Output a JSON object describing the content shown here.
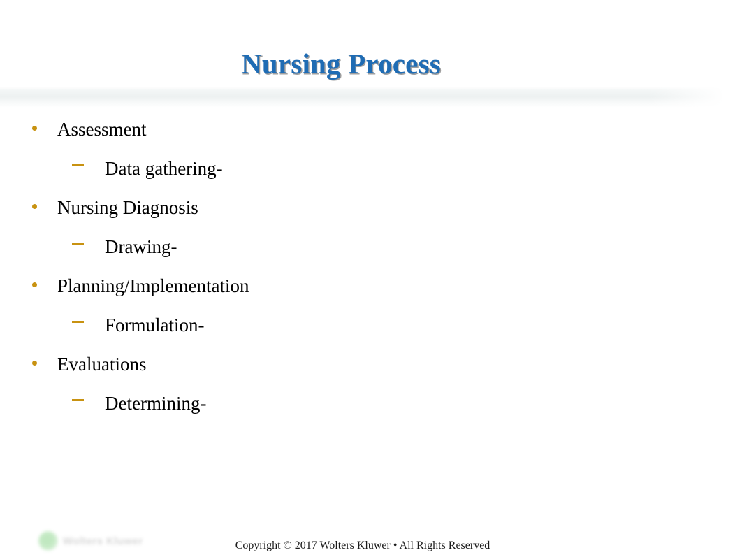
{
  "slide": {
    "title": "Nursing Process",
    "title_color": "#1F6CB4",
    "background_color": "#FFFFFF",
    "bullet_color": "#C89211",
    "body_text_color": "#000000"
  },
  "body": {
    "items": [
      {
        "level": 1,
        "marker": "dot-bullet",
        "text": "Assessment"
      },
      {
        "level": 2,
        "marker": "dash-bullet",
        "text": "Data gathering-"
      },
      {
        "level": 1,
        "marker": "dot-bullet",
        "text": "Nursing Diagnosis"
      },
      {
        "level": 2,
        "marker": "dash-bullet",
        "text": "Drawing-"
      },
      {
        "level": 1,
        "marker": "dot-bullet",
        "text": "Planning/Implementation"
      },
      {
        "level": 2,
        "marker": "dash-bullet",
        "text": "Formulation-"
      },
      {
        "level": 1,
        "marker": "dot-bullet",
        "text": "Evaluations"
      },
      {
        "level": 2,
        "marker": "dash-bullet",
        "text": "Determining-"
      }
    ]
  },
  "footer": {
    "copyright": "Copyright © 2017 Wolters Kluwer • All Rights Reserved",
    "logo_wordmark": "Wolters Kluwer",
    "logo_icon": "green-circle-logo-icon",
    "logo_color": "#5EC45E"
  }
}
